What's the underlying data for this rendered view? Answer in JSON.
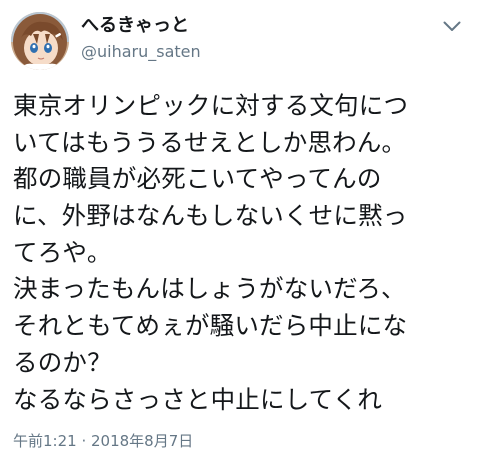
{
  "tweet": {
    "display_name": "へるきゃっと",
    "handle": "@uiharu_saten",
    "body_lines": [
      "東京オリンピックに対する文句につ",
      "いてはもううるせえとしか思わん。",
      "都の職員が必死こいてやってんの",
      "に、外野はなんもしないくせに黙っ",
      "てろや。",
      "決まったもんはしょうがないだろ、",
      "それともてめぇが騒いだら中止にな",
      "るのか？",
      "なるならさっさと中止にしてくれ"
    ],
    "timestamp": "午前1:21 · 2018年8月7日",
    "menu_icon": "chevron-down-icon",
    "avatar_icon": "user-avatar"
  },
  "colors": {
    "text": "#14171a",
    "secondary": "#657786",
    "background": "#ffffff"
  }
}
